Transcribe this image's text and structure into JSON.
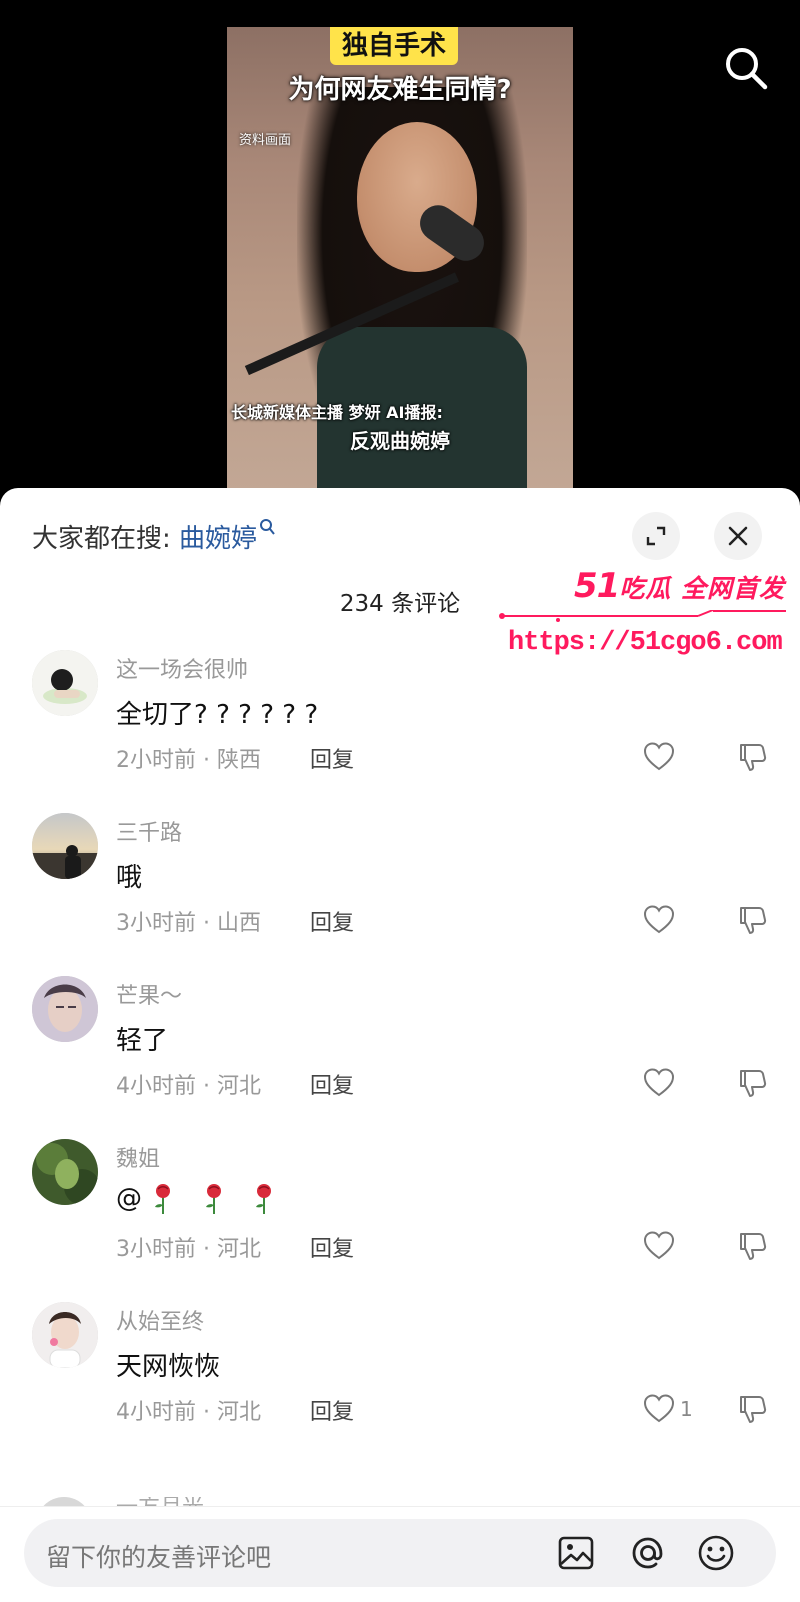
{
  "video": {
    "badge": "独自手术",
    "title": "为何网友难生同情?",
    "source_label": "资料画面",
    "caption_line1": "长城新媒体主播 梦妍 AI播报:",
    "caption_line2": "反观曲婉婷"
  },
  "panel": {
    "hot_search_prefix": "大家都在搜: ",
    "hot_search_keyword": "曲婉婷",
    "comment_count": "234 条评论"
  },
  "watermark": {
    "brand_num": "51",
    "brand_text": "吃瓜 全网首发",
    "url": "https://51cgo6.com"
  },
  "comments": [
    {
      "user": "这一场会很帅",
      "text": "全切了? ? ? ? ? ?",
      "meta": "2小时前 · 陕西",
      "reply": "回复",
      "likes": ""
    },
    {
      "user": "三千路",
      "text": "哦",
      "meta": "3小时前 · 山西",
      "reply": "回复",
      "likes": ""
    },
    {
      "user": "芒果～",
      "text": "轻了",
      "meta": "4小时前 · 河北",
      "reply": "回复",
      "likes": ""
    },
    {
      "user": "魏姐",
      "text": "@",
      "meta": "3小时前 · 河北",
      "reply": "回复",
      "likes": ""
    },
    {
      "user": "从始至终",
      "text": "天网恢恢",
      "meta": "4小时前 · 河北",
      "reply": "回复",
      "likes": "1"
    }
  ],
  "partial_comment_user": "一方月光",
  "input": {
    "placeholder": "留下你的友善评论吧"
  },
  "colors": {
    "link": "#2a5a9e",
    "watermark": "#ff1a5e",
    "badge": "#ffe34a"
  }
}
